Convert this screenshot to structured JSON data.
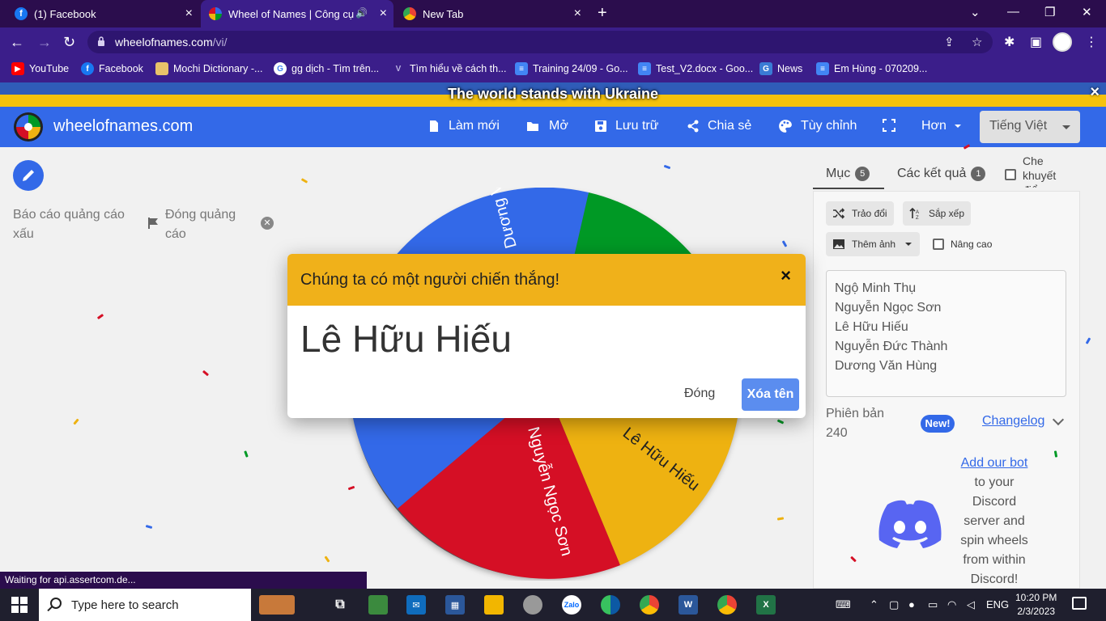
{
  "browser": {
    "tabs": [
      {
        "title": "(1) Facebook",
        "icon": "facebook-icon"
      },
      {
        "title": "Wheel of Names | Công cụ c",
        "icon": "wheelofnames-icon"
      },
      {
        "title": "New Tab",
        "icon": "chrome-icon"
      }
    ],
    "url_host": "wheelofnames.com",
    "url_path": "/vi/",
    "bookmarks": [
      {
        "label": "YouTube",
        "icon": "youtube-icon",
        "color": "#ff0000"
      },
      {
        "label": "Facebook",
        "icon": "facebook-icon",
        "color": "#1877f2"
      },
      {
        "label": "Mochi Dictionary -...",
        "icon": "mochi-icon",
        "color": "#e8c36a"
      },
      {
        "label": "gg dịch - Tìm trên...",
        "icon": "google-icon",
        "color": "#ffffff"
      },
      {
        "label": "Tìm hiểu về cách th...",
        "icon": "v-icon",
        "color": "#b8b0e0"
      },
      {
        "label": "Training 24/09 - Go...",
        "icon": "gdocs-icon",
        "color": "#4285f4"
      },
      {
        "label": "Test_V2.docx - Goo...",
        "icon": "gdocs-icon",
        "color": "#4285f4"
      },
      {
        "label": "News",
        "icon": "news-icon",
        "color": "#3a7bd5"
      },
      {
        "label": "Em Hùng - 070209...",
        "icon": "gdocs-icon",
        "color": "#4285f4"
      }
    ],
    "status": "Waiting for api.assertcom.de..."
  },
  "banner": {
    "text": "The world stands with Ukraine",
    "close": "×"
  },
  "header": {
    "brand": "wheelofnames.com",
    "buttons": [
      {
        "label": "Làm mới",
        "icon": "file-icon"
      },
      {
        "label": "Mở",
        "icon": "folder-icon"
      },
      {
        "label": "Lưu trữ",
        "icon": "save-icon"
      },
      {
        "label": "Chia sẻ",
        "icon": "share-icon"
      },
      {
        "label": "Tùy chỉnh",
        "icon": "palette-icon"
      },
      {
        "label": "",
        "icon": "fullscreen-icon"
      },
      {
        "label": "Hơn",
        "icon": "chevron-down-icon"
      }
    ],
    "language": "Tiếng Việt"
  },
  "ads": {
    "report": "Báo cáo quảng cáo xấu",
    "close": "Đóng quảng cáo"
  },
  "wheel": {
    "segments": [
      {
        "name": "Dương Văn Hùng",
        "color": "#3369e8"
      },
      {
        "name": "Ngộ Minh Thụ",
        "color": "#009925"
      },
      {
        "name": "Lê Hữu Hiếu",
        "color": "#eeb211"
      },
      {
        "name": "Nguyễn Ngọc Sơn",
        "color": "#d50f25"
      },
      {
        "name": "Nguyễn Đức Thành",
        "color": "#3369e8"
      }
    ]
  },
  "sidebar": {
    "tab_entries": "Mục",
    "entries_count": "5",
    "tab_results": "Các kết quả",
    "results_count": "1",
    "hide_label": "Che khuyết điểm",
    "shuffle": "Trảo đổi",
    "sort": "Sắp xếp",
    "add_image": "Thêm ảnh",
    "advanced": "Nâng cao",
    "names": [
      "Ngộ Minh Thụ",
      "Nguyễn Ngọc Sơn",
      "Lê Hữu Hiếu",
      "Nguyễn Đức Thành",
      "Dương Văn Hùng"
    ],
    "version_label": "Phiên bản",
    "version_num": "240",
    "new_badge": "New!",
    "changelog": "Changelog",
    "discord_link": "Add our bot",
    "discord_text": [
      "to your",
      "Discord",
      "server and",
      "spin wheels",
      "from within",
      "Discord!"
    ]
  },
  "modal": {
    "title": "Chúng ta có một người chiến thắng!",
    "close_icon": "×",
    "winner": "Lê Hữu Hiếu",
    "close_button": "Đóng",
    "remove_button": "Xóa tên"
  },
  "taskbar": {
    "search_placeholder": "Type here to search",
    "language": "ENG",
    "time": "10:20 PM",
    "date": "2/3/2023"
  }
}
